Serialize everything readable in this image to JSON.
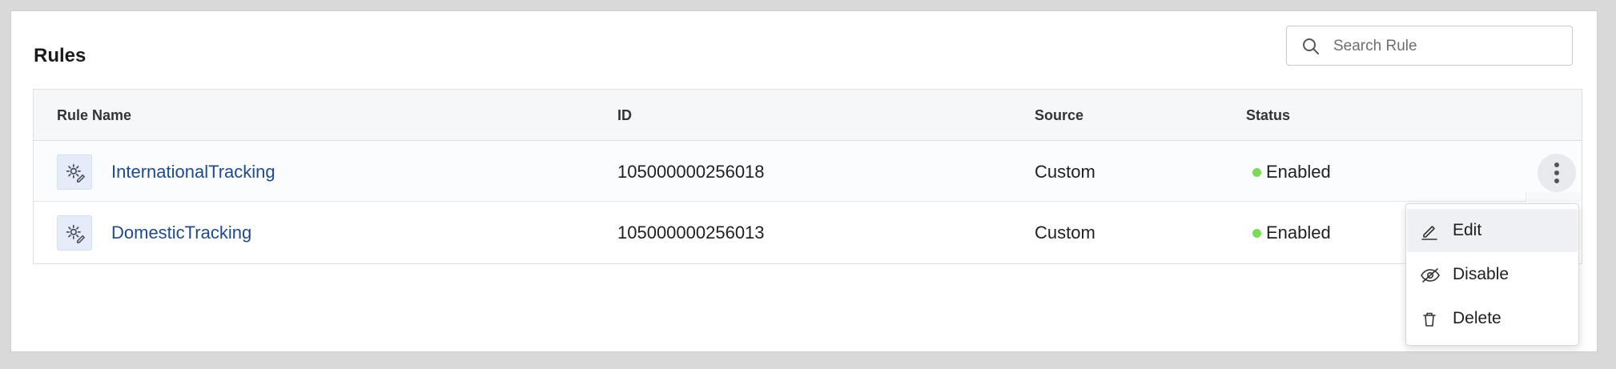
{
  "header": {
    "title": "Rules"
  },
  "search": {
    "placeholder": "Search Rule",
    "value": ""
  },
  "table": {
    "columns": [
      "Rule Name",
      "ID",
      "Source",
      "Status"
    ],
    "rows": [
      {
        "name": "InternationalTracking",
        "id": "105000000256018",
        "source": "Custom",
        "status": "Enabled"
      },
      {
        "name": "DomesticTracking",
        "id": "105000000256013",
        "source": "Custom",
        "status": "Enabled"
      }
    ]
  },
  "context_menu": {
    "items": [
      {
        "label": "Edit",
        "icon": "pencil-icon"
      },
      {
        "label": "Disable",
        "icon": "eye-off-icon"
      },
      {
        "label": "Delete",
        "icon": "trash-icon"
      }
    ]
  },
  "colors": {
    "link": "#1f4a8c",
    "status_enabled": "#7ed957",
    "header_bg": "#f6f7f9"
  }
}
